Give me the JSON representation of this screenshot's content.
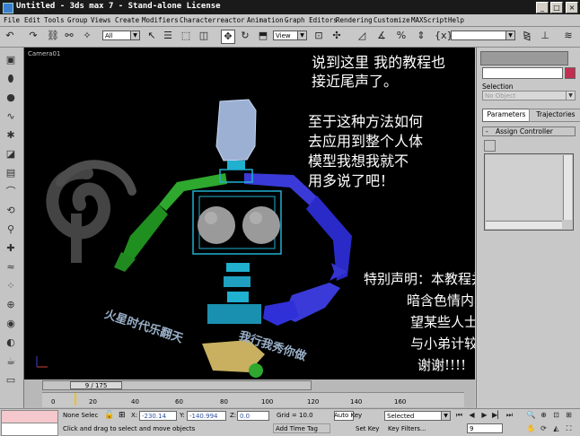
{
  "window": {
    "title": "Untitled - 3ds max 7 - Stand-alone License",
    "minimize": "_",
    "maximize": "□",
    "close": "×"
  },
  "menu": [
    "File",
    "Edit",
    "Tools",
    "Group",
    "Views",
    "Create",
    "Modifiers",
    "Character",
    "reactor",
    "Animation",
    "Graph Editors",
    "Rendering",
    "Customize",
    "MAXScript",
    "Help"
  ],
  "toolbar": {
    "filter_value": "All",
    "refcoord_value": "View"
  },
  "viewport": {
    "label": "Camera01",
    "overlay_lines_1": [
      "说到这里 我的教程也",
      "接近尾声了。"
    ],
    "overlay_lines_2": [
      "至于这种方法如何",
      "去应用到整个人体",
      "模型我想我就不",
      "用多说了吧！"
    ],
    "overlay_lines_3": [
      "特别声明：本教程并非",
      "暗含色情内容，",
      "望某些人士不要",
      "与小弟计较！",
      "谢谢!!!!"
    ],
    "watermark_1": "火星时代乐翻天",
    "watermark_2": "我行我秀你做"
  },
  "command_panel": {
    "section_label": "Selection",
    "dropdown_value": "No Object",
    "tabs": [
      "Parameters",
      "Trajectories"
    ],
    "rollout_title": "Assign Controller",
    "rollout_sign": "-"
  },
  "timeline": {
    "frame_label": "9 / 175",
    "ruler_labels": [
      "0",
      "20",
      "40",
      "60",
      "80",
      "100",
      "120",
      "140",
      "160"
    ]
  },
  "status": {
    "selection_text": "None Selec",
    "x_label": "X:",
    "x_value": "-230.14",
    "y_label": "Y:",
    "y_value": "-140.994",
    "z_label": "Z:",
    "z_value": "0.0",
    "grid_text": "Grid = 10.0",
    "autokey_label": "Auto Key",
    "selected_value": "Selected",
    "setkey_label": "Set Key",
    "keyfilters_label": "Key Filters...",
    "prompt_text": "Click and drag to select and move objects",
    "addtimetag_label": "Add Time Tag",
    "current_frame": "9"
  },
  "colors": {
    "viewport_bg": "#000000",
    "panel_bg": "#c8c8c8",
    "helper_cyan": "#20b0d0",
    "arm_blue": "#3a3ad8",
    "arm_green": "#2ea82e",
    "head": "#9cb0d4",
    "pelvis": "#c8b060",
    "swatch_red": "#c03050"
  }
}
